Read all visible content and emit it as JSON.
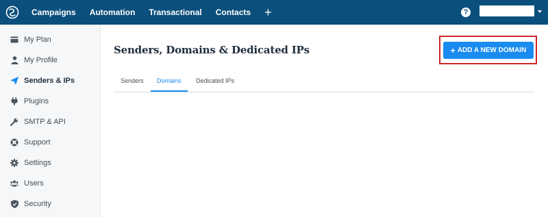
{
  "topnav": {
    "items": [
      "Campaigns",
      "Automation",
      "Transactional",
      "Contacts"
    ],
    "add_symbol": "+",
    "help_symbol": "?"
  },
  "sidebar": {
    "items": [
      {
        "label": "My Plan",
        "icon": "card-icon"
      },
      {
        "label": "My Profile",
        "icon": "user-icon"
      },
      {
        "label": "Senders & IPs",
        "icon": "paper-plane-icon",
        "active": true
      },
      {
        "label": "Plugins",
        "icon": "plug-icon"
      },
      {
        "label": "SMTP & API",
        "icon": "wrench-icon"
      },
      {
        "label": "Support",
        "icon": "lifebuoy-icon"
      },
      {
        "label": "Settings",
        "icon": "gear-icon"
      },
      {
        "label": "Users",
        "icon": "users-icon"
      },
      {
        "label": "Security",
        "icon": "shield-check-icon"
      }
    ]
  },
  "main": {
    "title": "Senders, Domains & Dedicated IPs",
    "cta_label": "ADD A NEW DOMAIN",
    "cta_symbol": "+",
    "tabs": [
      {
        "label": "Senders"
      },
      {
        "label": "Domains",
        "active": true
      },
      {
        "label": "Dedicated IPs"
      }
    ]
  },
  "colors": {
    "topbar": "#0b4f7c",
    "accent": "#1a8cf0",
    "highlight_frame": "#d0252a",
    "sidebar_bg": "#f6f7f8"
  }
}
